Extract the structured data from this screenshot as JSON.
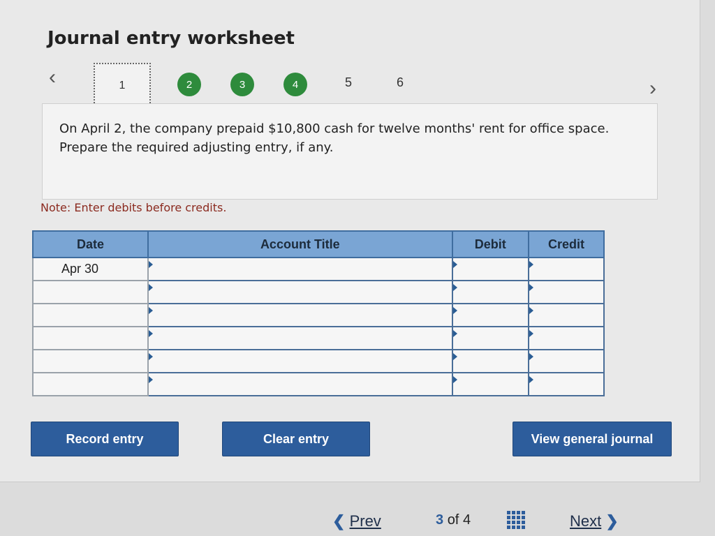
{
  "title": "Journal entry worksheet",
  "steps": [
    "1",
    "2",
    "3",
    "4",
    "5",
    "6"
  ],
  "nav_icons": {
    "left": "chevron-left-icon",
    "right": "chevron-right-icon"
  },
  "question": "On April 2, the company prepaid $10,800 cash for twelve months' rent for office space. Prepare the required adjusting entry, if any.",
  "note": "Note: Enter debits before credits.",
  "table": {
    "headers": {
      "date": "Date",
      "account": "Account Title",
      "debit": "Debit",
      "credit": "Credit"
    },
    "rows": [
      {
        "date": "Apr 30",
        "account": "",
        "debit": "",
        "credit": ""
      },
      {
        "date": "",
        "account": "",
        "debit": "",
        "credit": ""
      },
      {
        "date": "",
        "account": "",
        "debit": "",
        "credit": ""
      },
      {
        "date": "",
        "account": "",
        "debit": "",
        "credit": ""
      },
      {
        "date": "",
        "account": "",
        "debit": "",
        "credit": ""
      },
      {
        "date": "",
        "account": "",
        "debit": "",
        "credit": ""
      }
    ]
  },
  "buttons": {
    "record": "Record entry",
    "clear": "Clear entry",
    "view": "View general journal"
  },
  "footer": {
    "prev": "Prev",
    "page_current": "3",
    "page_of": "of",
    "page_total": "4",
    "next": "Next"
  },
  "colors": {
    "accent": "#2d5d9c",
    "step_done": "#2e8b3c",
    "note": "#8b2a1f",
    "header": "#7aa5d4"
  }
}
